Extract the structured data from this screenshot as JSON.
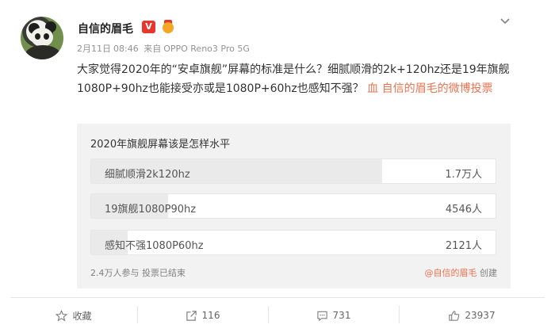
{
  "author": {
    "name": "自信的眉毛",
    "verified_badge": "V"
  },
  "meta": {
    "date": "2月11日",
    "time": "08:46",
    "source_prefix": "来自",
    "device": "OPPO Reno3 Pro 5G"
  },
  "post": {
    "text": "大家觉得2020年的“安卓旗舰”屏幕的标准是什么？细腻顺滑的2k+120hz还是19年旗舰1080P+90hz也能接受亦或是1080P+60hz也知不强？",
    "text_html_parts": [
      "大家觉得2020年的“安卓旗舰”屏幕的标准是什么？细腻顺滑的2k+120hz还是19年旗舰1080P+90hz也能接受亦或是1080P+60hz也感知不强？ "
    ],
    "vote_link": "血 自信的眉毛的微博投票"
  },
  "vote": {
    "title": "2020年旗舰屏幕该是怎样水平",
    "options": [
      {
        "label": "细腻顺滑2k120hz",
        "count": "1.7万人",
        "share": 0.72
      },
      {
        "label": "19旗舰1080P90hz",
        "count": "4546人",
        "share": 0.19
      },
      {
        "label": "感知不强1080P60hz",
        "count": "2121人",
        "share": 0.09
      }
    ],
    "footer": "2.4万人参与 投票已结束",
    "creator_name": "@自信的眉毛",
    "creator_suffix": "创建"
  },
  "actions": {
    "favorite": "收藏",
    "share": "116",
    "comment": "731",
    "like": "23937"
  },
  "colors": {
    "accent": "#eb7350",
    "verified": "#e8352e"
  }
}
